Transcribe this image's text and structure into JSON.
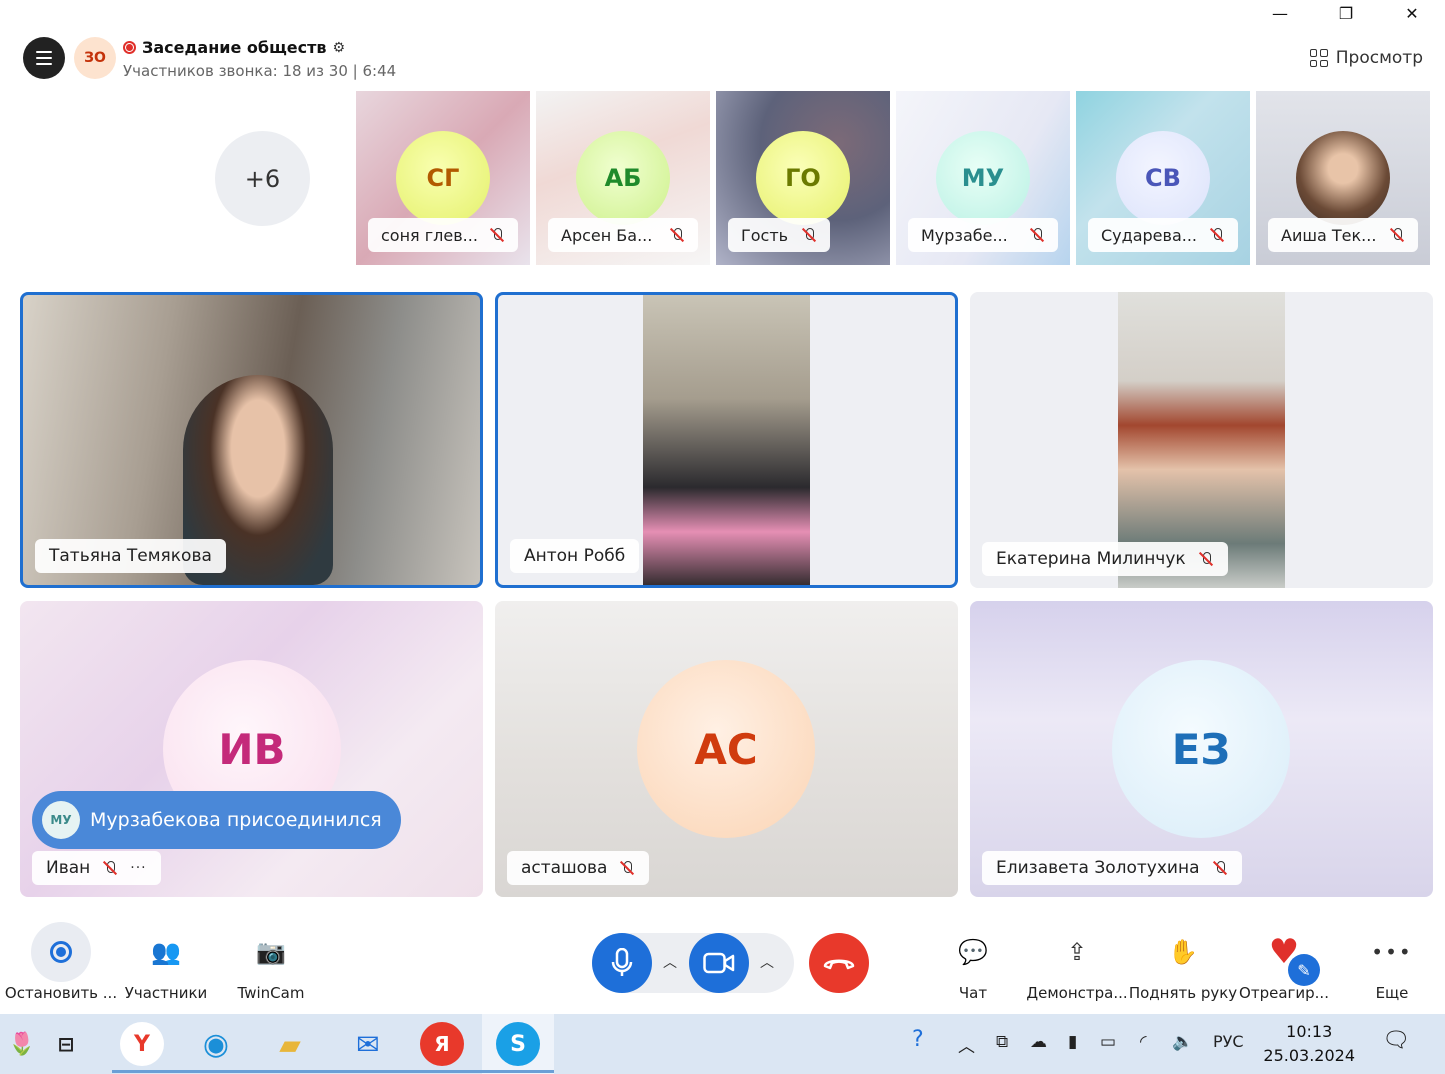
{
  "window": {
    "minimize": "—",
    "restore": "❐",
    "close": "✕"
  },
  "header": {
    "group_initials": "ЗО",
    "title": "Заседание обществ",
    "subtitle": "Участников звонка: 18 из 30 | 6:44",
    "view_label": "Просмотр"
  },
  "strip": {
    "more_label": "+6",
    "thumbs": [
      {
        "initials": "СГ",
        "name": "соня глев...",
        "color": "#c96a00"
      },
      {
        "initials": "АБ",
        "name": "Арсен Ба...",
        "color": "#1f8a2a"
      },
      {
        "initials": "ГО",
        "name": "Гость",
        "color": "#6b8a00"
      },
      {
        "initials": "МУ",
        "name": "Мурзабе...",
        "color": "#2a8f8f"
      },
      {
        "initials": "СВ",
        "name": "Сударева...",
        "color": "#4a56b8"
      },
      {
        "initials": "",
        "name": "Аиша Тек...",
        "color": "#333333"
      }
    ]
  },
  "tiles": [
    {
      "name": "Татьяна Темякова"
    },
    {
      "name": "Антон Робб"
    },
    {
      "name": "Екатерина Милинчук"
    },
    {
      "name": "Иван",
      "initials": "ИВ",
      "more": "···"
    },
    {
      "name": "асташова",
      "initials": "АС"
    },
    {
      "name": "Елизавета Золотухина",
      "initials": "ЕЗ"
    }
  ],
  "toast": {
    "initials": "МУ",
    "text": "Мурзабекова присоединился"
  },
  "toolbar": {
    "record_label": "Остановить ...",
    "participants_label": "Участники",
    "twincam_label": "TwinCam",
    "chat_label": "Чат",
    "share_label": "Демонстра...",
    "raise_hand_label": "Поднять руку",
    "react_label": "Отреагир...",
    "more_label": "Еще"
  },
  "taskbar": {
    "lang": "РУС",
    "time": "10:13",
    "date": "25.03.2024"
  },
  "colors": {
    "accent": "#1e6fd9",
    "end_call": "#e8392b",
    "record": "#e0302b"
  }
}
